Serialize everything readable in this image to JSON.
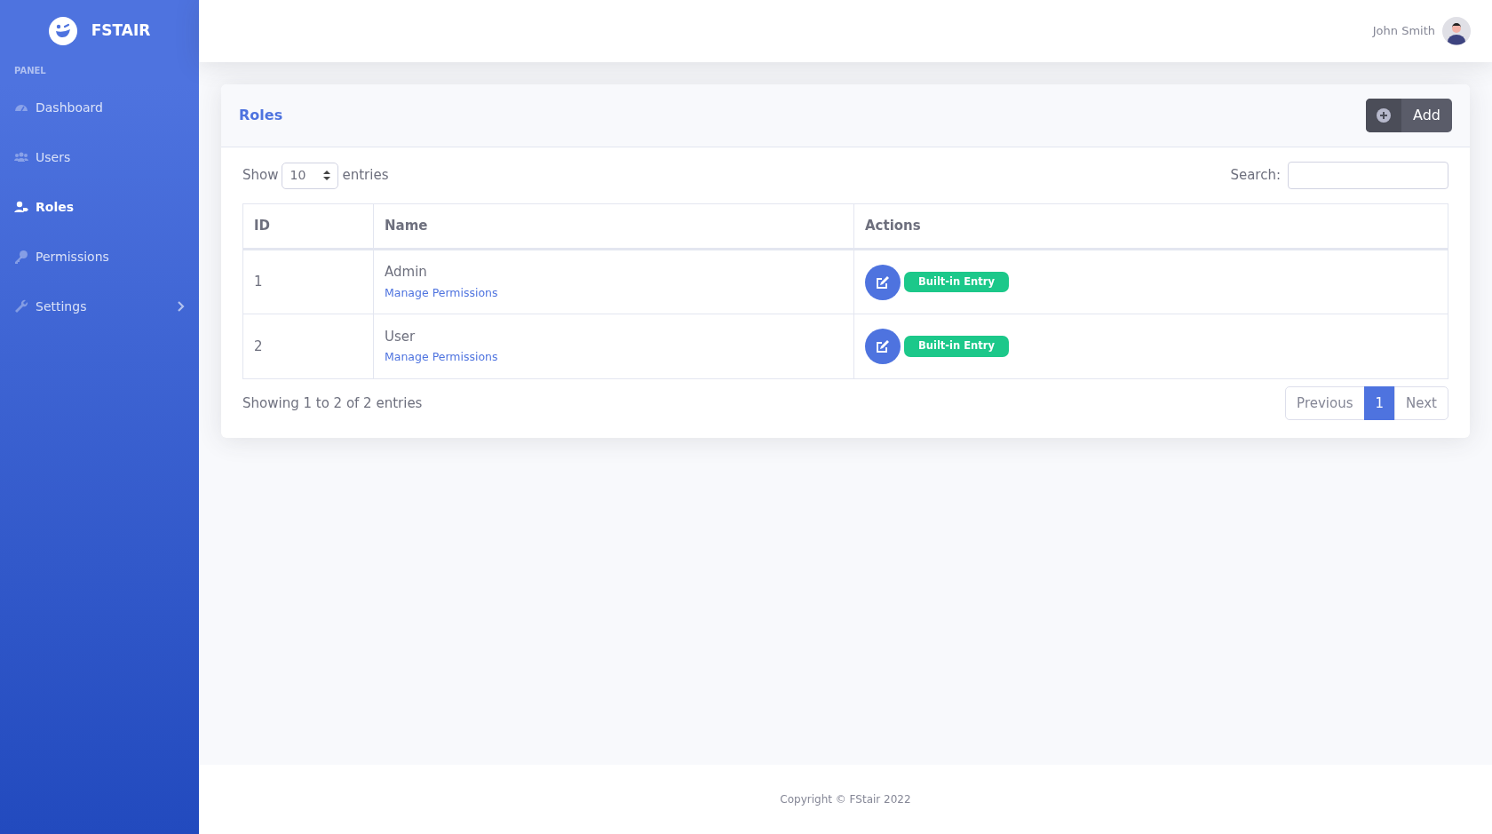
{
  "brand": {
    "name": "FSTAIR"
  },
  "sidebar": {
    "heading": "PANEL",
    "items": [
      {
        "label": "Dashboard",
        "selected": false,
        "expandable": false
      },
      {
        "label": "Users",
        "selected": false,
        "expandable": false
      },
      {
        "label": "Roles",
        "selected": true,
        "expandable": false
      },
      {
        "label": "Permissions",
        "selected": false,
        "expandable": false
      },
      {
        "label": "Settings",
        "selected": false,
        "expandable": true
      }
    ]
  },
  "topbar": {
    "user_name": "John Smith"
  },
  "card": {
    "title": "Roles",
    "add_button": "Add",
    "length": {
      "before": "Show",
      "value": "10",
      "after": "entries"
    },
    "search": {
      "label": "Search:"
    },
    "table": {
      "columns": [
        "ID",
        "Name",
        "Actions"
      ],
      "rows": [
        {
          "id": "1",
          "name": "Admin",
          "link": "Manage Permissions",
          "badge": "Built-in Entry"
        },
        {
          "id": "2",
          "name": "User",
          "link": "Manage Permissions",
          "badge": "Built-in Entry"
        }
      ]
    },
    "info": "Showing 1 to 2 of 2 entries",
    "pagination": [
      {
        "label": "Previous",
        "selected": false
      },
      {
        "label": "1",
        "selected": true
      },
      {
        "label": "Next",
        "selected": false
      }
    ]
  },
  "footer": {
    "text": "Copyright © FStair 2022"
  }
}
